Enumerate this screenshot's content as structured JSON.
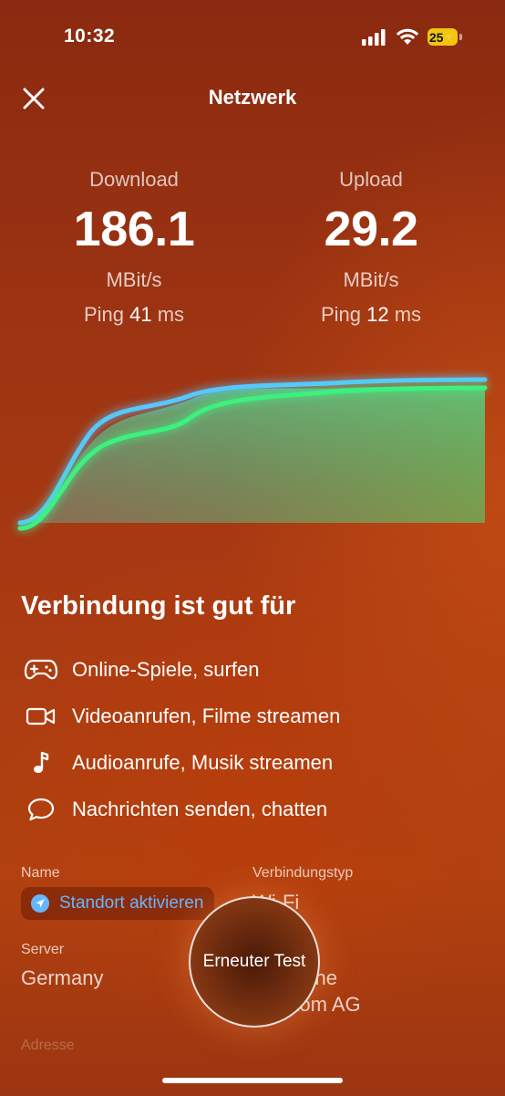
{
  "status_bar": {
    "time": "10:32",
    "battery": "25"
  },
  "header": {
    "title": "Netzwerk",
    "close_icon": "close-icon"
  },
  "download": {
    "label": "Download",
    "value": "186.1",
    "unit": "MBit/s",
    "ping_label": "Ping",
    "ping_value": "41",
    "ping_unit": "ms"
  },
  "upload": {
    "label": "Upload",
    "value": "29.2",
    "unit": "MBit/s",
    "ping_label": "Ping",
    "ping_value": "12",
    "ping_unit": "ms"
  },
  "colors": {
    "download_line": "#57c8ff",
    "upload_line": "#3ef07f",
    "link": "#66b6ff",
    "battery": "#f2c60f"
  },
  "suitable": {
    "title": "Verbindung ist gut für",
    "items": [
      {
        "icon": "gamepad-icon",
        "label": "Online-Spiele, surfen"
      },
      {
        "icon": "video-camera-icon",
        "label": "Videoanrufen, Filme streamen"
      },
      {
        "icon": "music-note-icon",
        "label": "Audioanrufe, Musik streamen"
      },
      {
        "icon": "chat-bubble-icon",
        "label": "Nachrichten senden, chatten"
      }
    ]
  },
  "details": {
    "name_label": "Name",
    "location_button": "Standort aktivieren",
    "connection_type_label": "Verbindungstyp",
    "connection_type_value": "Wi-Fi",
    "server_label": "Server",
    "server_value": "Germany",
    "provider_value_line1": "Deutsche",
    "provider_value_line2": "Telekom AG",
    "address_label": "Adresse"
  },
  "retest_button": "Erneuter Test"
}
